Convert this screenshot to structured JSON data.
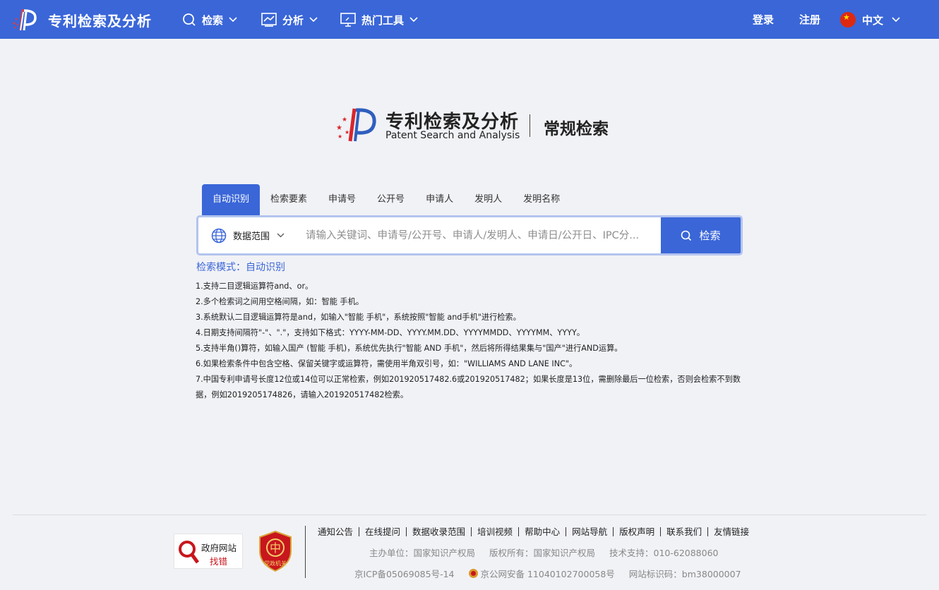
{
  "header": {
    "brand": "专利检索及分析",
    "nav": [
      {
        "label": "检索",
        "icon": "search-icon"
      },
      {
        "label": "分析",
        "icon": "chart-icon"
      },
      {
        "label": "热门工具",
        "icon": "monitor-icon"
      }
    ],
    "login": "登录",
    "register": "注册",
    "language": "中文"
  },
  "hero": {
    "cn": "专利检索及分析",
    "en": "Patent Search and Analysis",
    "subtitle": "常规检索"
  },
  "tabs": [
    "自动识别",
    "检索要素",
    "申请号",
    "公开号",
    "申请人",
    "发明人",
    "发明名称"
  ],
  "search": {
    "scope_label": "数据范围",
    "placeholder": "请输入关键词、申请号/公开号、申请人/发明人、申请日/公开日、IPC分...",
    "value": "",
    "button_label": "检索"
  },
  "help": {
    "mode_title": "检索模式：自动识别",
    "items": [
      "1.支持二目逻辑运算符and、or。",
      "2.多个检索词之间用空格间隔，如：智能 手机。",
      "3.系统默认二目逻辑运算符是and，如输入\"智能 手机\"，系统按照\"智能 and手机\"进行检索。",
      "4.日期支持间隔符\"-\"、\".\"，支持如下格式：YYYY-MM-DD、YYYY.MM.DD、YYYYMMDD、YYYYMM、YYYY。",
      "5.支持半角()算符，如输入国产 (智能 手机)，系统优先执行\"智能 AND 手机\"，然后将所得结果集与\"国产\"进行AND运算。",
      "6.如果检索条件中包含空格、保留关键字或运算符，需使用半角双引号，如：\"WILLIAMS AND LANE INC\"。",
      "7.中国专利申请号长度12位或14位可以正常检索，例如201920517482.6或201920517482；如果长度是13位，需删除最后一位检索，否则会检索不到数据，例如2019205174826，请输入201920517482检索。"
    ]
  },
  "footer": {
    "gov_badge_line1": "政府网站",
    "gov_badge_line2": "找错",
    "party_badge": "党政机关",
    "links": [
      "通知公告",
      "在线提问",
      "数据收录范围",
      "培训视频",
      "帮助中心",
      "网站导航",
      "版权声明",
      "联系我们",
      "友情链接"
    ],
    "host": "主办单位：国家知识产权局",
    "copyright": "版权所有：国家知识产权局",
    "support": "技术支持：010-62088060",
    "icp": "京ICP备05069085号-14",
    "police": "京公网安备 11040102700058号",
    "site_id": "网站标识码：bm38000007"
  },
  "colors": {
    "primary": "#3a66d8",
    "page_bg": "#f1f2f6",
    "search_border": "#b3c4ee",
    "badge_red": "#c8161d"
  }
}
